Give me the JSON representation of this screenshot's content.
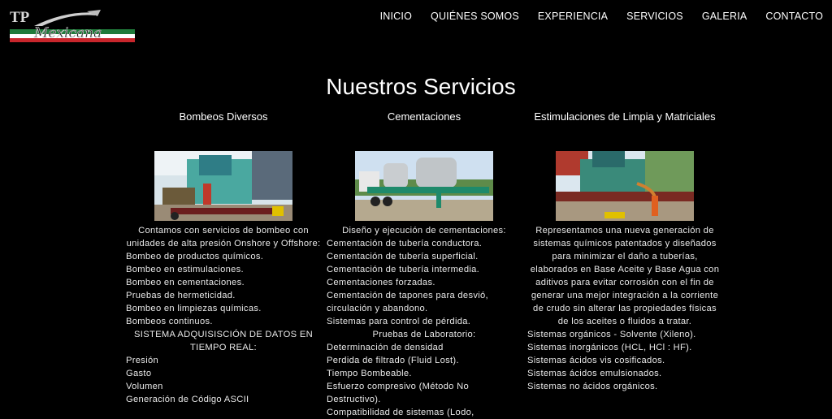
{
  "logo": {
    "tp": "TP",
    "script": "Mexicana"
  },
  "nav": [
    "INICIO",
    "QUIÉNES SOMOS",
    "EXPERIENCIA",
    "SERVICIOS",
    "GALERIA",
    "CONTACTO"
  ],
  "page_title": "Nuestros Servicios",
  "columns": [
    {
      "heading": "Bombeos Diversos",
      "lines": [
        {
          "t": "Contamos con servicios de bombeo con unidades de alta presión Onshore y Offshore:",
          "c": true
        },
        {
          "t": "Bombeo de productos químicos."
        },
        {
          "t": "Bombeo en estimulaciones."
        },
        {
          "t": "Bombeo en cementaciones."
        },
        {
          "t": "Pruebas de hermeticidad."
        },
        {
          "t": "Bombeo en limpiezas químicas."
        },
        {
          "t": "Bombeos continuos."
        },
        {
          "t": "SISTEMA ADQUISISCIÓN DE DATOS EN TIEMPO REAL:",
          "c": true
        },
        {
          "t": "Presión"
        },
        {
          "t": "Gasto"
        },
        {
          "t": "Volumen"
        },
        {
          "t": "Generación de Código ASCII"
        }
      ]
    },
    {
      "heading": "Cementaciones",
      "lines": [
        {
          "t": "Diseño y ejecución de cementaciones:",
          "c": true
        },
        {
          "t": "Cementación de tubería conductora."
        },
        {
          "t": "Cementación de tubería superficial."
        },
        {
          "t": "Cementación de tubería intermedia."
        },
        {
          "t": "Cementaciones forzadas."
        },
        {
          "t": "Cementación de tapones para desvió,"
        },
        {
          "t": "circulación y abandono."
        },
        {
          "t": "Sistemas para control de pérdida."
        },
        {
          "t": "Pruebas de Laboratorio:",
          "c": true
        },
        {
          "t": "Determinación de densidad"
        },
        {
          "t": "Perdida de filtrado (Fluid Lost)."
        },
        {
          "t": "Tiempo Bombeable."
        },
        {
          "t": "Esfuerzo compresivo (Método No"
        },
        {
          "t": "Destructivo)."
        },
        {
          "t": "Compatibilidad de sistemas (Lodo,"
        }
      ]
    },
    {
      "heading": "Estimulaciones de Limpia y Matriciales",
      "lines": [
        {
          "t": "Representamos una nueva generación de sistemas químicos patentados y diseñados para minimizar el daño a tuberías, elaborados en Base Aceite y Base Agua con aditivos para evitar corrosión con el fin de generar una mejor integración a la corriente de crudo sin alterar las propiedades físicas de los aceites o fluidos a tratar.",
          "c": true
        },
        {
          "t": "Sistemas orgánicos - Solvente (Xileno)."
        },
        {
          "t": "Sistemas inorgánicos (HCL, HCl : HF)."
        },
        {
          "t": "Sistemas ácidos vis cosificados."
        },
        {
          "t": "Sistemas ácidos emulsionados."
        },
        {
          "t": "Sistemas no ácidos orgánicos."
        }
      ]
    }
  ]
}
